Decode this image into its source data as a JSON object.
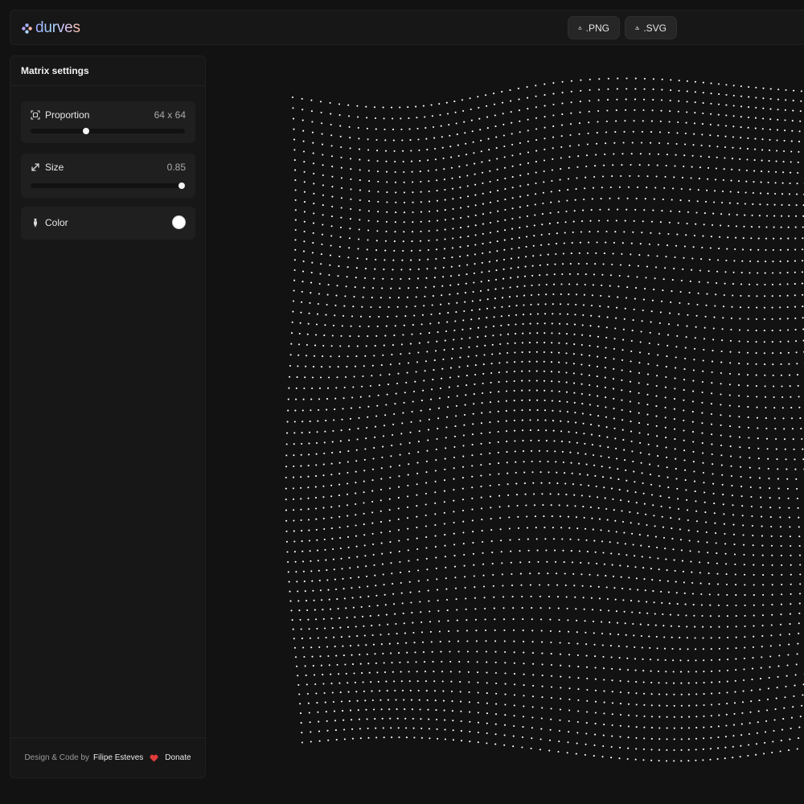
{
  "app": {
    "brand_name": "durves"
  },
  "toolbar": {
    "export_png_label": ".PNG",
    "export_svg_label": ".SVG"
  },
  "sidebar": {
    "title": "Matrix settings",
    "proportion": {
      "label": "Proportion",
      "value": "64 x 64",
      "slider_fraction": 0.36
    },
    "size": {
      "label": "Size",
      "value": "0.85",
      "slider_fraction": 0.98
    },
    "color": {
      "label": "Color",
      "value": "#ffffff"
    }
  },
  "footer": {
    "credit_prefix": "Design & Code by",
    "author": "Filipe Esteves",
    "donate_label": "Donate",
    "heart_color": "#e03a3a"
  },
  "matrix": {
    "rows": 64,
    "cols": 64,
    "dot_color": "#ffffff"
  }
}
